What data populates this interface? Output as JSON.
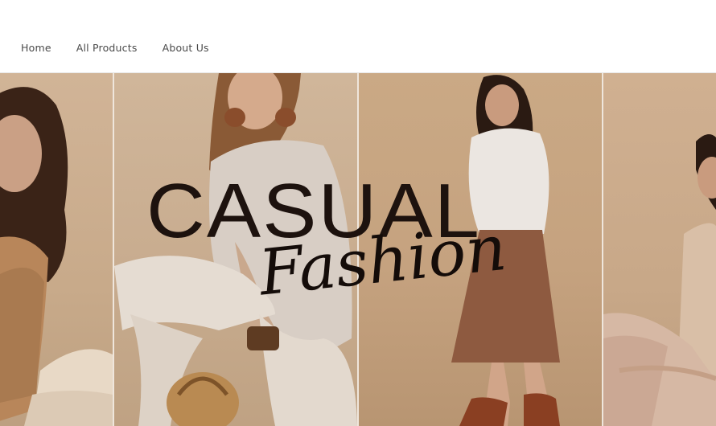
{
  "nav": {
    "items": [
      {
        "label": "Home"
      },
      {
        "label": "All Products"
      },
      {
        "label": "About Us"
      }
    ]
  },
  "hero": {
    "headline": "CASUAL",
    "subheadline": "Fashion",
    "colors": {
      "background": "#c9ab8c",
      "text": "#1d120e",
      "divider": "#efe6dc"
    },
    "images": [
      "woman-in-camel-sweater",
      "woman-seated-with-rattan-bag",
      "woman-in-white-top-brown-skirt",
      "woman-seated-in-beige-outfit"
    ]
  }
}
